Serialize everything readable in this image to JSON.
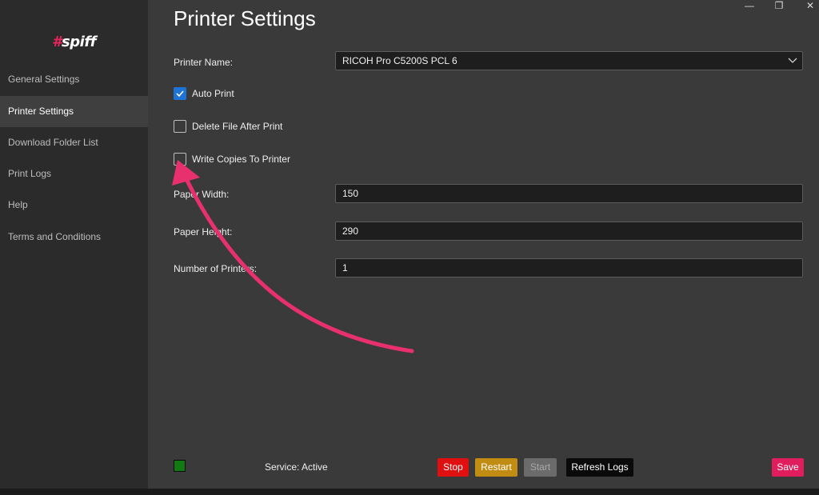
{
  "app": {
    "logo_hash": "#",
    "logo_text": "spiff",
    "brand_color": "#e8245c"
  },
  "sidebar": {
    "items": [
      {
        "label": "General Settings"
      },
      {
        "label": "Printer Settings",
        "active": true
      },
      {
        "label": "Download Folder List"
      },
      {
        "label": "Print Logs"
      },
      {
        "label": "Help"
      },
      {
        "label": "Terms and Conditions"
      }
    ]
  },
  "window_controls": {
    "minimize": "—",
    "restore": "❐",
    "close": "✕"
  },
  "main": {
    "title": "Printer Settings",
    "printer_name": {
      "label": "Printer Name:",
      "value": "RICOH Pro C5200S PCL 6"
    },
    "auto_print": {
      "label": "Auto Print",
      "checked": true
    },
    "delete_file": {
      "label": "Delete File After Print",
      "checked": false
    },
    "write_copies": {
      "label": "Write Copies To Printer",
      "checked": false
    },
    "paper_width": {
      "label": "Paper Width:",
      "value": "150"
    },
    "paper_height": {
      "label": "Paper Height:",
      "value": "290"
    },
    "num_printers": {
      "label": "Number of Printers:",
      "value": "1"
    }
  },
  "footer": {
    "service_status": "Service: Active",
    "status_color": "#127a12",
    "stop_label": "Stop",
    "restart_label": "Restart",
    "start_label": "Start",
    "refresh_label": "Refresh Logs",
    "save_label": "Save"
  },
  "annotation": {
    "arrow_color": "#e8306e"
  }
}
